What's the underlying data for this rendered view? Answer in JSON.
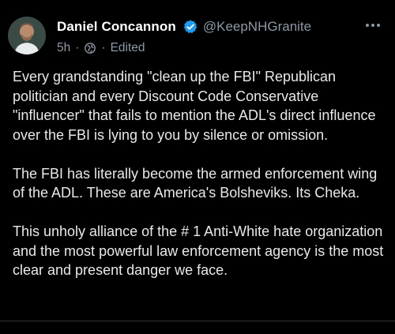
{
  "post": {
    "author": {
      "display_name": "Daniel Concannon",
      "handle": "@KeepNHGranite",
      "verified_icon": "verified-badge-icon",
      "avatar_icon": "avatar"
    },
    "meta": {
      "time": "5h",
      "separator": "·",
      "audience_icon": "globe-icon",
      "edited": "Edited"
    },
    "more_icon": "more-options-icon",
    "paragraphs": [
      "Every grandstanding \"clean up the FBI\" Republican politician and every Discount Code Conservative \"influencer\" that fails to mention the ADL's direct influence over the FBI is lying to you by silence or omission.",
      "The FBI has literally become the armed enforcement wing of the ADL. These are America's Bolsheviks. Its Cheka.",
      "This unholy alliance of the # 1 Anti-White hate organization and the most powerful law enforcement agency is the most clear and present danger we face."
    ]
  },
  "colors": {
    "background": "#000000",
    "text": "#e7e9ea",
    "secondary": "#8b98a5",
    "verified": "#1d9bf0"
  }
}
